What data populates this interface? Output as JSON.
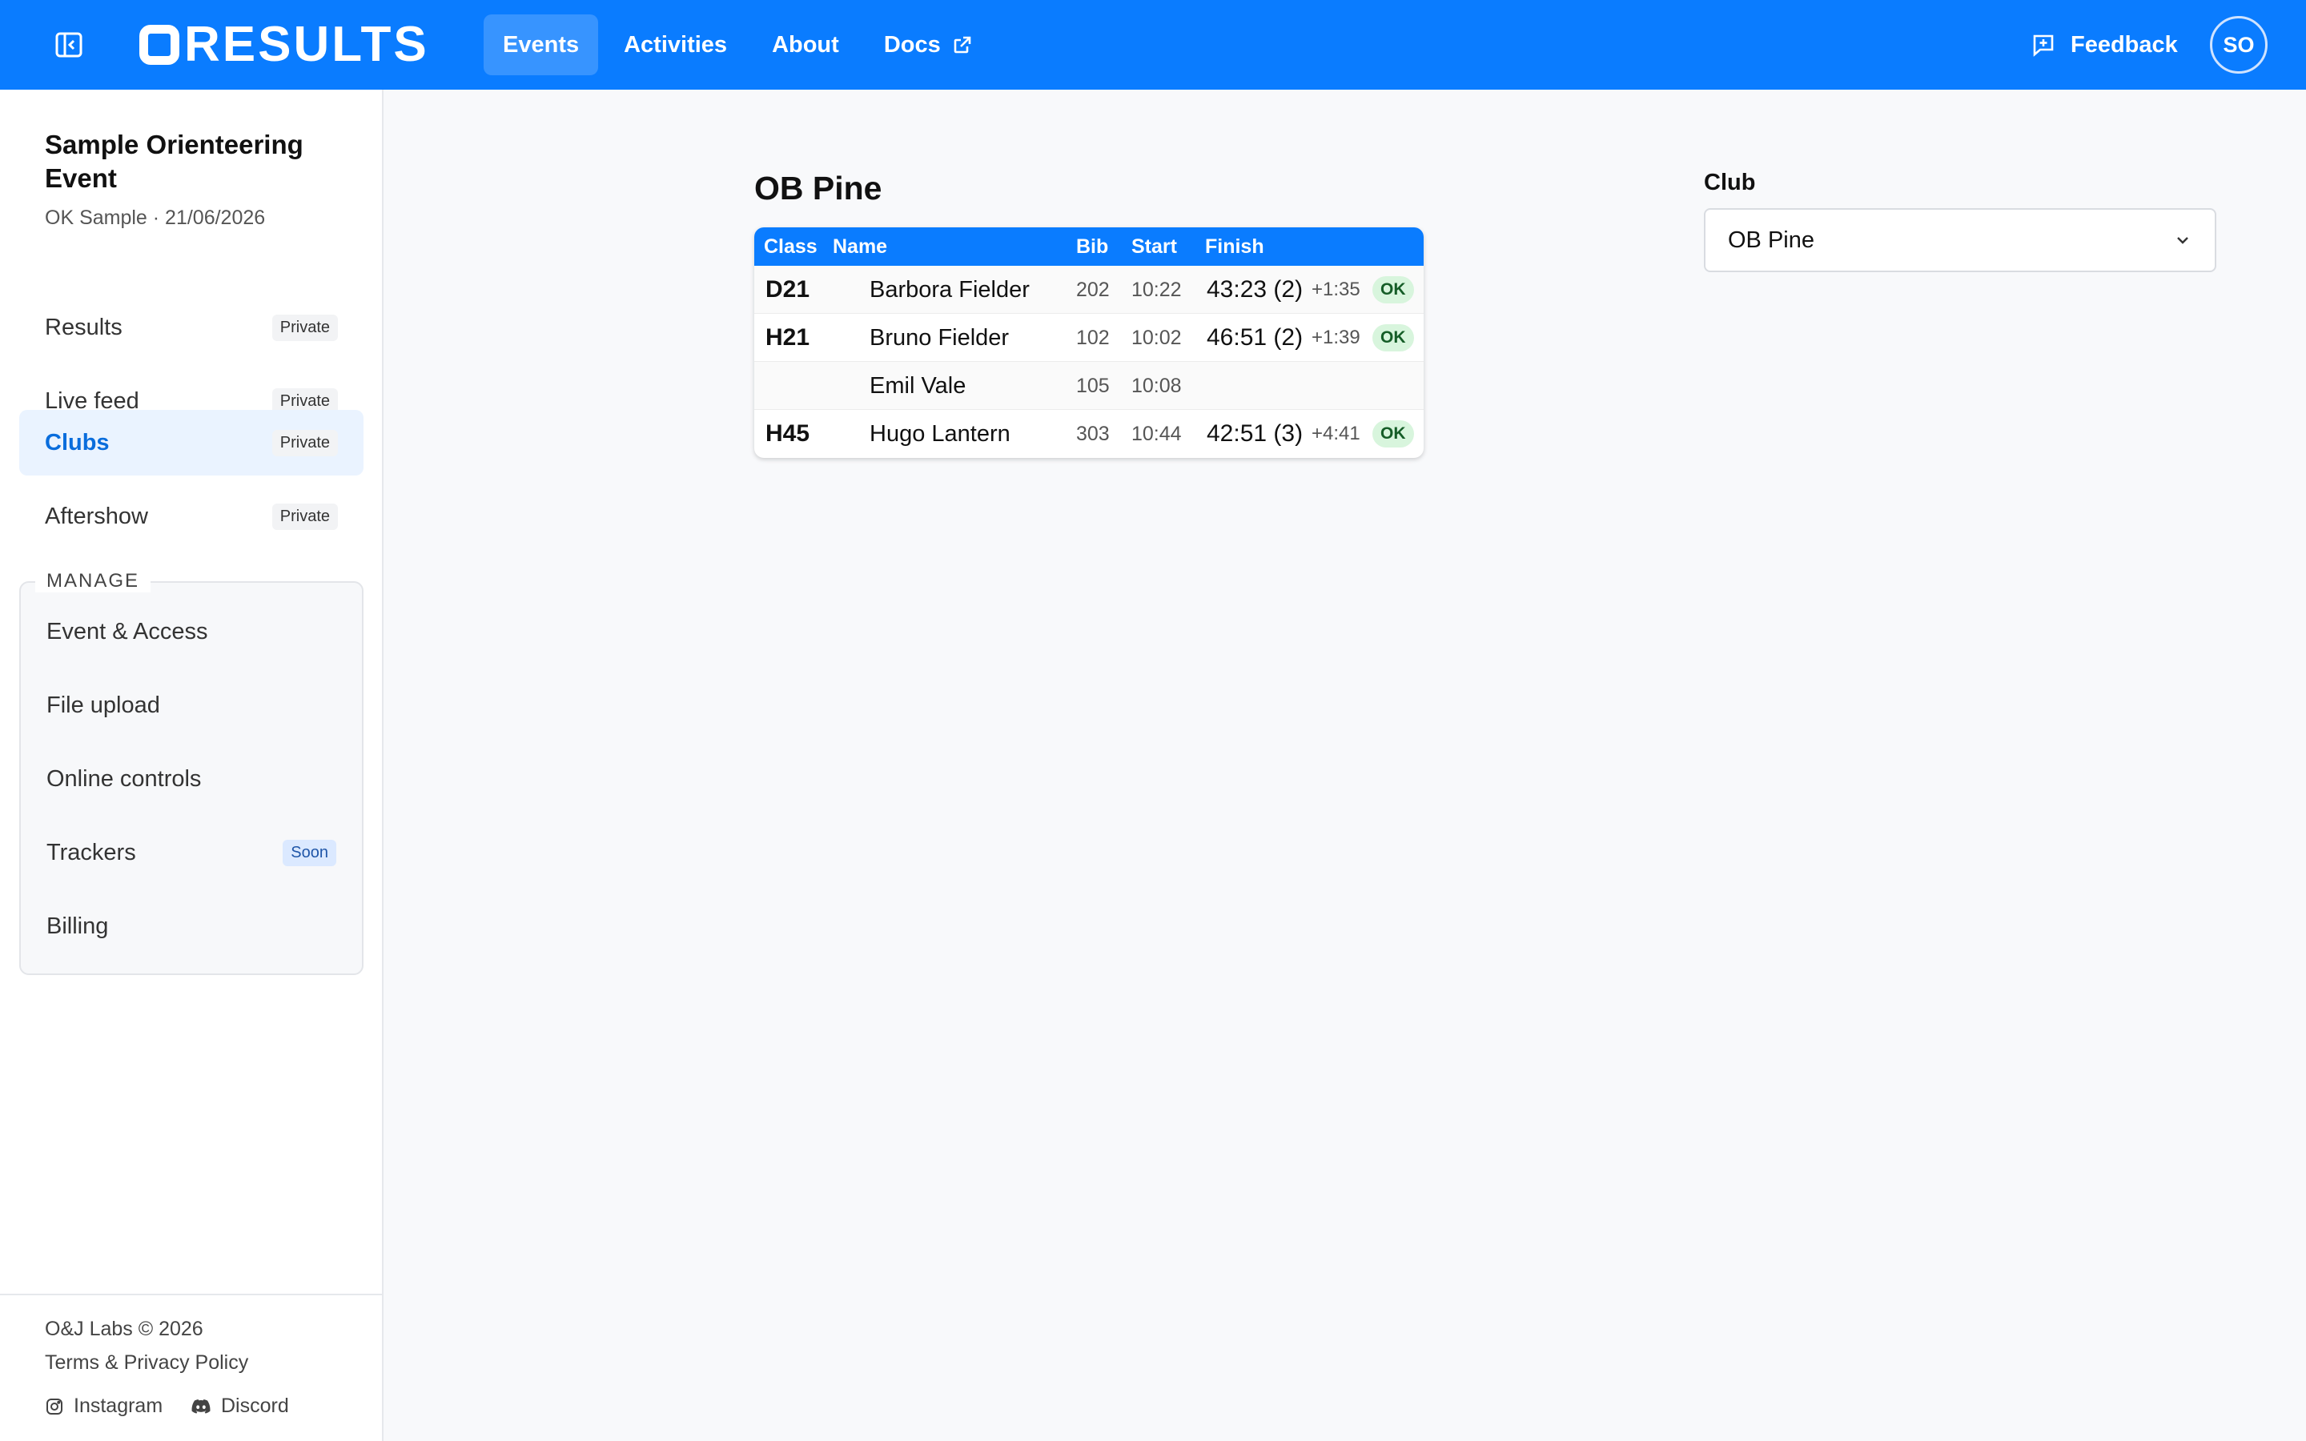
{
  "header": {
    "logo_text": "RESULTS",
    "nav": [
      {
        "label": "Events",
        "active": true
      },
      {
        "label": "Activities",
        "active": false
      },
      {
        "label": "About",
        "active": false
      },
      {
        "label": "Docs",
        "active": false,
        "icon": "external-link-icon"
      }
    ],
    "feedback_label": "Feedback",
    "avatar_initials": "SO"
  },
  "sidebar": {
    "event_title": "Sample Orienteering Event",
    "event_subtitle": "OK Sample · 21/06/2026",
    "items": [
      {
        "label": "Results",
        "badge": "Private",
        "active": false
      },
      {
        "label": "Live feed",
        "badge": "Private",
        "active": false
      },
      {
        "label": "Clubs",
        "badge": "Private",
        "active": true
      },
      {
        "label": "Aftershow",
        "badge": "Private",
        "active": false
      }
    ],
    "manage_title": "MANAGE",
    "manage_items": [
      {
        "label": "Event & Access",
        "badge": ""
      },
      {
        "label": "File upload",
        "badge": ""
      },
      {
        "label": "Online controls",
        "badge": ""
      },
      {
        "label": "Trackers",
        "badge": "Soon"
      },
      {
        "label": "Billing",
        "badge": ""
      }
    ],
    "footer": {
      "copyright": "O&J Labs © 2026",
      "terms": "Terms & Privacy Policy",
      "instagram": "Instagram",
      "discord": "Discord"
    }
  },
  "main": {
    "title": "OB Pine",
    "table": {
      "headers": [
        "Class",
        "Name",
        "Bib",
        "Start",
        "Finish"
      ],
      "rows": [
        {
          "class": "D21",
          "name": "Barbora Fielder",
          "bib": "202",
          "start": "10:22",
          "time": "43:23 (2)",
          "behind": "+1:35",
          "status": "OK"
        },
        {
          "class": "H21",
          "name": "Bruno Fielder",
          "bib": "102",
          "start": "10:02",
          "time": "46:51 (2)",
          "behind": "+1:39",
          "status": "OK"
        },
        {
          "class": "",
          "name": "Emil Vale",
          "bib": "105",
          "start": "10:08",
          "time": "",
          "behind": "",
          "status": ""
        },
        {
          "class": "H45",
          "name": "Hugo Lantern",
          "bib": "303",
          "start": "10:44",
          "time": "42:51 (3)",
          "behind": "+4:41",
          "status": "OK"
        }
      ]
    },
    "club_filter": {
      "label": "Club",
      "value": "OB Pine"
    }
  },
  "colors": {
    "brand": "#0a7cff",
    "active_nav": "#3794ff",
    "ok_badge_bg": "#d8f5dd",
    "active_sidebar_bg": "#eaf3ff"
  }
}
